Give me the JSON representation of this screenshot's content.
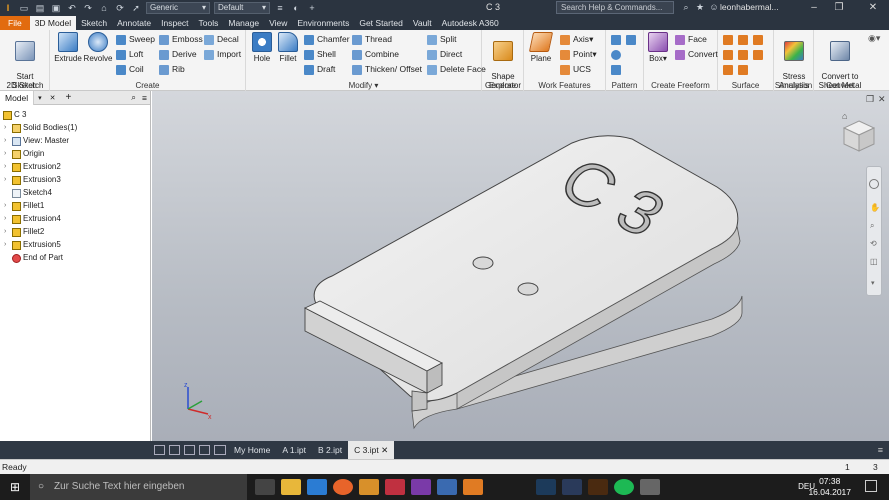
{
  "window_title": "C 3",
  "qat": {
    "appearance_value": "Generic",
    "material_value": "Default",
    "search_placeholder": "Search Help & Commands...",
    "user": "leonhabermal..."
  },
  "tabs": [
    "File",
    "3D Model",
    "Sketch",
    "Annotate",
    "Inspect",
    "Tools",
    "Manage",
    "View",
    "Environments",
    "Get Started",
    "Vault",
    "Autodesk A360"
  ],
  "ribbon": {
    "sketch": {
      "label": "Sketch",
      "start": "Start\n2D Sketch"
    },
    "create": {
      "label": "Create",
      "extrude": "Extrude",
      "revolve": "Revolve",
      "sweep": "Sweep",
      "loft": "Loft",
      "coil": "Coil",
      "emboss": "Emboss",
      "derive": "Derive",
      "rib": "Rib",
      "decal": "Decal",
      "import": "Import"
    },
    "modify": {
      "label": "Modify",
      "hole": "Hole",
      "fillet": "Fillet",
      "chamfer": "Chamfer",
      "shell": "Shell",
      "draft": "Draft",
      "thread": "Thread",
      "combine": "Combine",
      "thicken": "Thicken/ Offset",
      "split": "Split",
      "direct": "Direct",
      "delete_face": "Delete Face"
    },
    "explore": {
      "label": "Explore",
      "shape_generator": "Shape\nGenerator"
    },
    "work": {
      "label": "Work Features",
      "plane": "Plane",
      "axis": "Axis",
      "point": "Point",
      "ucs": "UCS"
    },
    "pattern": {
      "label": "Pattern"
    },
    "freeform": {
      "label": "Create Freeform",
      "box": "Box",
      "face": "Face",
      "convert": "Convert"
    },
    "surface": {
      "label": "Surface"
    },
    "simulation": {
      "label": "Simulation",
      "stress": "Stress\nAnalysis"
    },
    "convert": {
      "label": "Convert",
      "sheet_metal": "Convert to\nSheet Metal"
    }
  },
  "browser": {
    "tab": "Model",
    "root": "C 3",
    "nodes": [
      "Solid Bodies(1)",
      "View: Master",
      "Origin",
      "Extrusion2",
      "Extrusion3",
      "Sketch4",
      "Fillet1",
      "Extrusion4",
      "Fillet2",
      "Extrusion5",
      "End of Part"
    ]
  },
  "model_text": "C 3",
  "doc_tabs": [
    "My Home",
    "A 1.ipt",
    "B 2.ipt",
    "C 3.ipt"
  ],
  "status": {
    "text": "Ready",
    "count1": "1",
    "count2": "3"
  },
  "taskbar": {
    "search_placeholder": "Zur Suche Text hier eingeben",
    "lang": "DEU",
    "time": "07:38",
    "date": "16.04.2017"
  },
  "colors": {
    "file_tab": "#e26b0f",
    "dark_chrome": "#2b3440",
    "ribbon": "#f4f4f4"
  }
}
